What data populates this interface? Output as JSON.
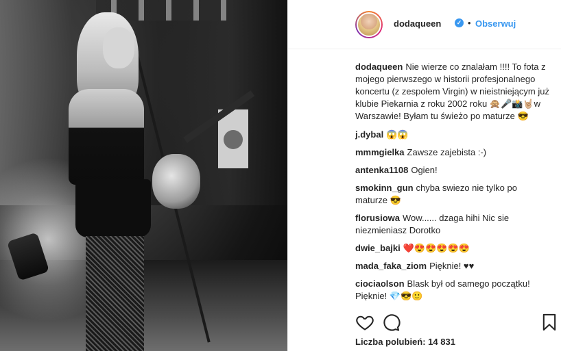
{
  "post": {
    "photo_alt": "",
    "header": {
      "username": "dodaqueen",
      "separator": "•",
      "follow_label": "Obserwuj"
    },
    "caption": {
      "username": "dodaqueen",
      "text": "Nie wierze co znalałam !!!! To fota z mojego pierwszego w historii profesjonalnego koncertu (z zespołem Virgin) w nieistniejącym już klubie Piekarnia z roku 2002 roku 🙊🎤📸🤘🏼w Warszawie! Byłam tu świeżo po maturze 😎"
    },
    "comments": [
      {
        "username": "j.dybal",
        "text": "😱😱"
      },
      {
        "username": "mmmgielka",
        "text": "Zawsze zajebista :-)"
      },
      {
        "username": "antenka1108",
        "text": "Ogien!"
      },
      {
        "username": "smokinn_gun",
        "text": "chyba swiezo nie tylko po maturze 😎"
      },
      {
        "username": "florusiowa",
        "text": "Wow...... dzaga hihi Nic sie niezmieniasz Dorotko"
      },
      {
        "username": "dwie_bajki",
        "text": "❤️😍😍😍😍😍"
      },
      {
        "username": "mada_faka_ziom",
        "text": "Pięknie! ♥♥"
      },
      {
        "username": "ciociaolson",
        "text": "Blask był od samego początku! Pięknie! 💎😎🙂"
      }
    ],
    "likes_text": "Liczba polubień: 14 831",
    "icons": {
      "like": "heart-icon",
      "comment": "comment-bubble-icon",
      "save": "bookmark-icon",
      "verified": "verified-badge-icon"
    },
    "colors": {
      "accent": "#3897f0",
      "text": "#262626",
      "border": "#efefef"
    }
  }
}
